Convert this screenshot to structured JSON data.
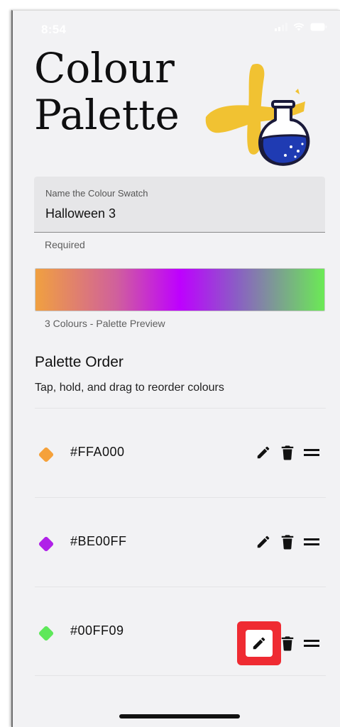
{
  "status_bar": {
    "time": "8:54"
  },
  "title": {
    "line1": "Colour",
    "line2": "Palette"
  },
  "name_field": {
    "label": "Name the Colour Swatch",
    "value": "Halloween 3",
    "helper": "Required"
  },
  "preview": {
    "caption": "3 Colours - Palette Preview",
    "gradient_colors": [
      "#FFA000",
      "#BE00FF",
      "#00FF09"
    ]
  },
  "palette_order": {
    "title": "Palette Order",
    "subtitle": "Tap, hold, and drag to reorder colours"
  },
  "colors": [
    {
      "hex": "#FFA000",
      "swatch": "#F5A13A"
    },
    {
      "hex": "#BE00FF",
      "swatch": "#B021E8"
    },
    {
      "hex": "#00FF09",
      "swatch": "#5EE85A"
    }
  ],
  "icons": {
    "edit": "pencil-icon",
    "delete": "trash-icon",
    "reorder": "drag-handle-icon"
  },
  "highlight_color": "#EF2B32"
}
